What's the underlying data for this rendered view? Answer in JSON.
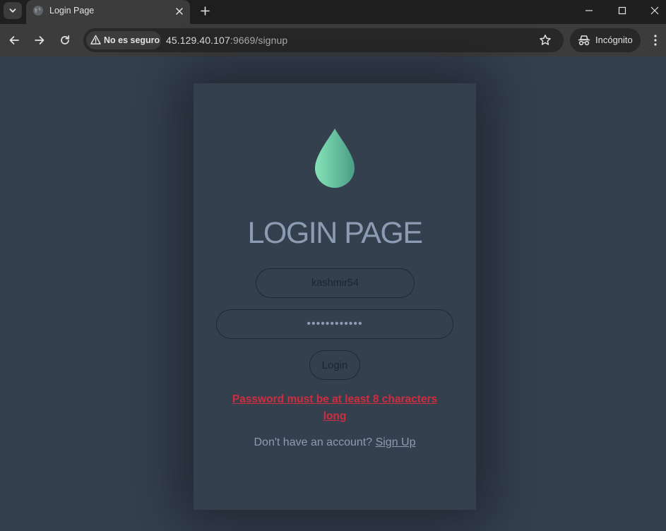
{
  "browser": {
    "tab": {
      "title": "Login Page"
    },
    "address": {
      "security_label": "No es seguro",
      "url_host": "45.129.40.107",
      "url_path": ":9669/signup"
    },
    "profile": {
      "label": "Incógnito"
    },
    "colors": {
      "tabbar": "#1f1f1f",
      "toolbar": "#3c3c3c",
      "omnibox": "#282828"
    }
  },
  "page": {
    "title": "LOGIN PAGE",
    "username_value": "kashmir54",
    "password_value": "••••••••••••",
    "login_button": "Login",
    "error_message": "Password must be at least 8 characters long",
    "signup_prompt": "Don't have an account?",
    "signup_link": "Sign Up",
    "colors": {
      "background": "#35404f",
      "text_muted": "#8d9bb3",
      "error": "#cf2c3e",
      "logo_gradient_start": "#86e3b8",
      "logo_gradient_end": "#4a9c86"
    }
  }
}
